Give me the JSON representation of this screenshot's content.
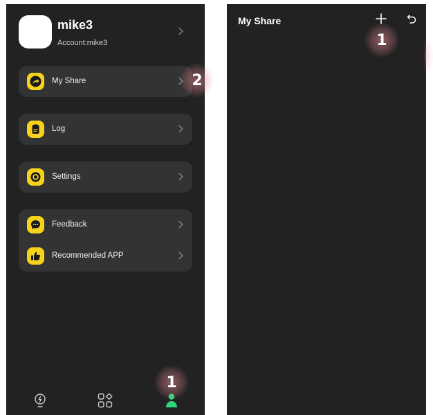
{
  "profile": {
    "username": "mike3",
    "account": "Account:mike3"
  },
  "menu": {
    "my_share": "My Share",
    "log": "Log",
    "settings": "Settings",
    "feedback": "Feedback",
    "recommended_app": "Recommended APP"
  },
  "icons": {
    "profile_chevron": "chevron-right-icon",
    "my_share": "share-arrow-icon",
    "log": "clipboard-icon",
    "settings": "gear-icon",
    "feedback": "chat-bubble-icon",
    "recommended_app": "thumbs-up-icon",
    "nav_scenes": "lightbulb-icon",
    "nav_apps": "grid-icon",
    "nav_profile": "person-icon",
    "add": "plus-icon",
    "back": "back-arrow-icon"
  },
  "bottom_nav": {
    "active": "profile"
  },
  "share_page": {
    "title": "My Share"
  },
  "markers": {
    "nav_profile_step": "1",
    "my_share_step": "2",
    "add_step": "1"
  },
  "colors": {
    "background": "#222222",
    "card": "#333333",
    "accent_yellow": "#f6d21a",
    "nav_active_green": "#2fd67a",
    "marker_glow": "#ec8c96"
  }
}
